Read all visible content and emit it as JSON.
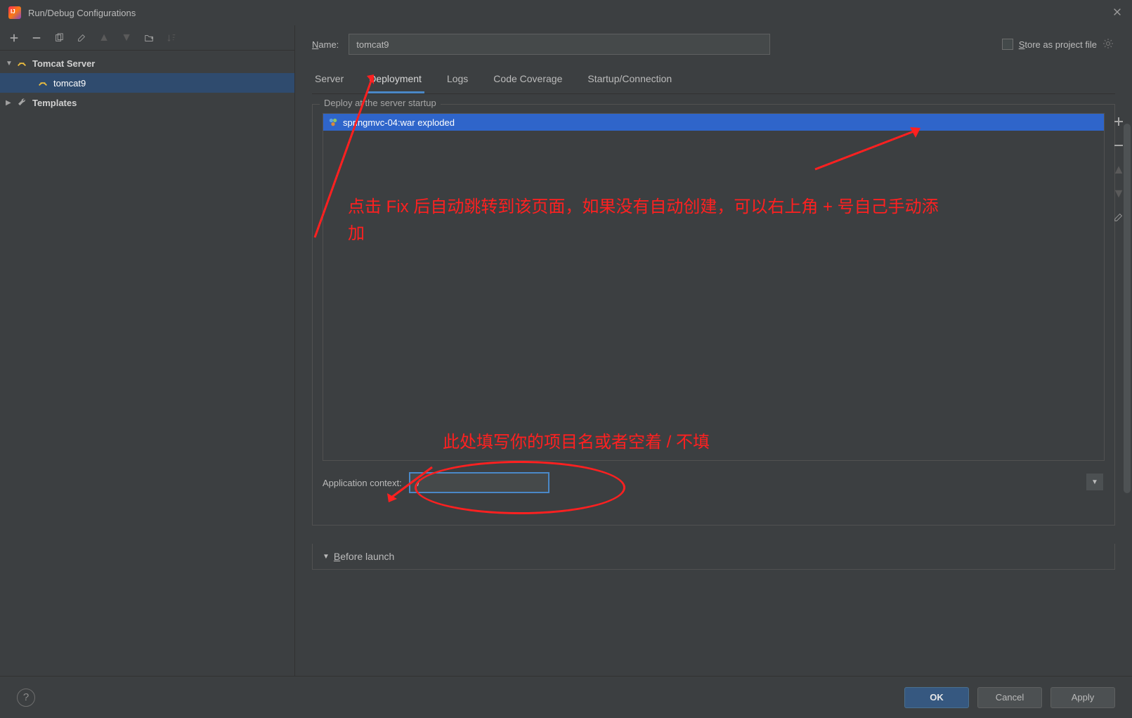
{
  "window": {
    "title": "Run/Debug Configurations"
  },
  "tree": {
    "category": "Tomcat Server",
    "config_name": "tomcat9",
    "templates": "Templates"
  },
  "form": {
    "name_label_prefix": "N",
    "name_label_rest": "ame:",
    "name_value": "tomcat9",
    "store_label_prefix": "S",
    "store_label_rest": "tore as project file"
  },
  "tabs": {
    "server": "Server",
    "deployment": "Deployment",
    "logs": "Logs",
    "code_coverage": "Code Coverage",
    "startup": "Startup/Connection"
  },
  "deploy": {
    "section_label": "Deploy at the server startup",
    "artifact": "springmvc-04:war exploded",
    "appctx_label": "Application context:",
    "appctx_value": "/"
  },
  "before_launch": {
    "title_prefix": "B",
    "title_rest": "efore launch"
  },
  "buttons": {
    "ok": "OK",
    "cancel": "Cancel",
    "apply": "Apply"
  },
  "annotations": {
    "note1": "点击 Fix 后自动跳转到该页面，如果没有自动创建，可以右上角 + 号自己手动添加",
    "note2": "此处填写你的项目名或者空着 / 不填"
  }
}
